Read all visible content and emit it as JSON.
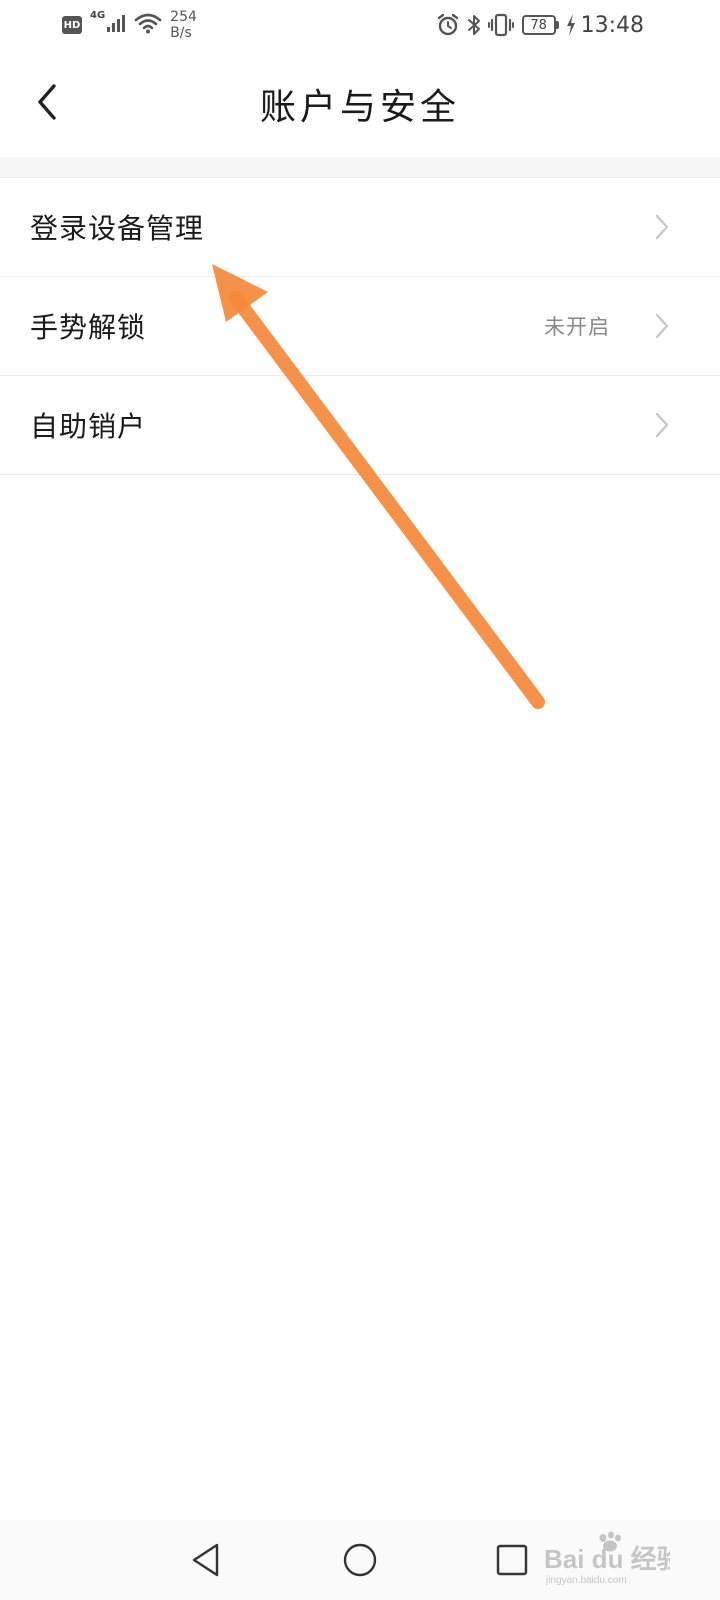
{
  "status_bar": {
    "hd": "HD",
    "network": "4G",
    "speed_value": "254",
    "speed_unit": "B/s",
    "battery": "78",
    "time": "13:48",
    "icons": [
      "hd-icon",
      "signal-icon",
      "wifi-icon",
      "alarm-icon",
      "bluetooth-icon",
      "vibrate-icon",
      "battery-icon",
      "charging-icon"
    ]
  },
  "header": {
    "title": "账户与安全",
    "back_icon": "chevron-left-icon"
  },
  "menu": {
    "items": [
      {
        "label": "登录设备管理",
        "value": ""
      },
      {
        "label": "手势解锁",
        "value": "未开启"
      },
      {
        "label": "自助销户",
        "value": ""
      }
    ]
  },
  "annotation": {
    "color": "#f5883a"
  },
  "nav_bar": {
    "icons": [
      "nav-back-icon",
      "nav-home-icon",
      "nav-recent-icon"
    ]
  },
  "watermark": {
    "brand": "Bai du 经验",
    "url": "jingyan.baidu.com"
  },
  "colors": {
    "divider": "#ececec",
    "text_primary": "#1a1a1a",
    "text_secondary": "#888888",
    "chevron": "#c8c8c8"
  }
}
